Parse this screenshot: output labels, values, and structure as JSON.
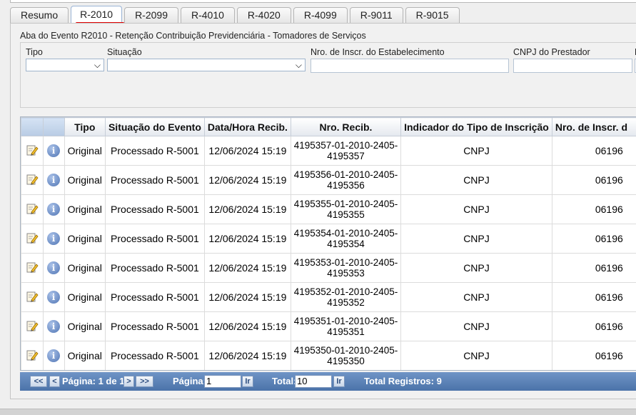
{
  "tabs": [
    "Resumo",
    "R-2010",
    "R-2099",
    "R-4010",
    "R-4020",
    "R-4099",
    "R-9011",
    "R-9015"
  ],
  "active_tab": "R-2010",
  "panel_title": "Aba do Evento R2010 - Retenção Contribuição Previdenciária - Tomadores de Serviços",
  "filters": {
    "tipo_label": "Tipo",
    "situacao_label": "Situação",
    "nro_inscr_label": "Nro. de Inscr. do Estabelecimento",
    "cnpj_label": "CNPJ do Prestador",
    "cut_label": "N",
    "tipo_value": "",
    "situacao_value": "",
    "nro_inscr_value": "",
    "cnpj_value": ""
  },
  "table": {
    "headers": [
      "Tipo",
      "Situação do Evento",
      "Data/Hora Recib.",
      "Nro. Recib.",
      "Indicador do Tipo de Inscrição",
      "Nro. de Inscr. d"
    ],
    "rows": [
      {
        "tipo": "Original",
        "situacao": "Processado R-5001",
        "data": "12/06/2024 15:19",
        "recib1": "4195357-01-2010-2405-",
        "recib2": "4195357",
        "indicador": "CNPJ",
        "inscr": "06196"
      },
      {
        "tipo": "Original",
        "situacao": "Processado R-5001",
        "data": "12/06/2024 15:19",
        "recib1": "4195356-01-2010-2405-",
        "recib2": "4195356",
        "indicador": "CNPJ",
        "inscr": "06196"
      },
      {
        "tipo": "Original",
        "situacao": "Processado R-5001",
        "data": "12/06/2024 15:19",
        "recib1": "4195355-01-2010-2405-",
        "recib2": "4195355",
        "indicador": "CNPJ",
        "inscr": "06196"
      },
      {
        "tipo": "Original",
        "situacao": "Processado R-5001",
        "data": "12/06/2024 15:19",
        "recib1": "4195354-01-2010-2405-",
        "recib2": "4195354",
        "indicador": "CNPJ",
        "inscr": "06196"
      },
      {
        "tipo": "Original",
        "situacao": "Processado R-5001",
        "data": "12/06/2024 15:19",
        "recib1": "4195353-01-2010-2405-",
        "recib2": "4195353",
        "indicador": "CNPJ",
        "inscr": "06196"
      },
      {
        "tipo": "Original",
        "situacao": "Processado R-5001",
        "data": "12/06/2024 15:19",
        "recib1": "4195352-01-2010-2405-",
        "recib2": "4195352",
        "indicador": "CNPJ",
        "inscr": "06196"
      },
      {
        "tipo": "Original",
        "situacao": "Processado R-5001",
        "data": "12/06/2024 15:19",
        "recib1": "4195351-01-2010-2405-",
        "recib2": "4195351",
        "indicador": "CNPJ",
        "inscr": "06196"
      },
      {
        "tipo": "Original",
        "situacao": "Processado R-5001",
        "data": "12/06/2024 15:19",
        "recib1": "4195350-01-2010-2405-",
        "recib2": "4195350",
        "indicador": "CNPJ",
        "inscr": "06196"
      }
    ]
  },
  "pager": {
    "first": "<<",
    "prev": "<",
    "page_info": "Página: 1 de 1",
    "next": ">",
    "last": ">>",
    "goto_label": "Página:",
    "goto_value": "1",
    "go_button": "Ir",
    "total_label": "Total:",
    "total_value": "10",
    "total_go_button": "Ir",
    "total_registros": "Total Registros: 9"
  },
  "colors": {
    "accent": "#4b73a9",
    "tab_underline": "#e10000"
  }
}
